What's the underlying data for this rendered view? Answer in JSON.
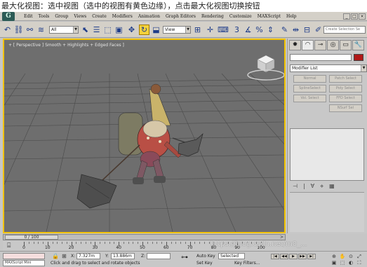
{
  "caption": "最大化视图：选中视图（选中的视图有黄色边缘），点击最大化视图切换按钮",
  "app": {
    "logo": "G",
    "menu": [
      "Edit",
      "Tools",
      "Group",
      "Views",
      "Create",
      "Modifiers",
      "Animation",
      "Graph Editors",
      "Rendering",
      "Customize",
      "MAXScript",
      "Help"
    ],
    "window_buttons": [
      "_",
      "□",
      "×"
    ]
  },
  "toolbar": {
    "selection_filter": "All",
    "reference_coord": "View",
    "search_placeholder": "Create Selection Se",
    "snap_label": "3",
    "angle_snap_label": "%"
  },
  "viewport": {
    "label": "+ [ Perspective ] Smooth + Highlights + Edged Faces ]",
    "active_border_color": "#f2c300"
  },
  "watermark": "https://blog.csdn.net/m0_...",
  "command_panel": {
    "tabs": [
      "✹",
      "◠",
      "⊸",
      "◎",
      "▭",
      "🔧"
    ],
    "modifier_list": "Modifier List",
    "buttons": [
      "Normal",
      "Patch Select",
      "SplineSelect",
      "Poly Select",
      "Vol. Select",
      "FFD Select",
      "",
      "NSurf Sel"
    ],
    "stack_tools": [
      "⊣",
      "|",
      "∀",
      "⋄",
      "▦"
    ]
  },
  "time": {
    "current": "0 / 100",
    "ticks": [
      "0",
      "10",
      "20",
      "30",
      "40",
      "50",
      "60",
      "70",
      "80",
      "90",
      "100"
    ]
  },
  "status": {
    "maxscript_label": "MAXScript Mini",
    "x_label": "X:",
    "x_value": "7.327m",
    "y_label": "Y:",
    "y_value": "13.886m",
    "z_label": "Z:",
    "z_value": "",
    "prompt": "Click and drag to select and rotate objects",
    "auto_key": "Auto Key",
    "set_key": "Set Key",
    "selected": "Selected",
    "key_filters": "Key Filters...",
    "playback": [
      "|◀",
      "◀◀",
      "▶",
      "▶▶",
      "▶|"
    ],
    "nav_icons": [
      "⊕",
      "✋",
      "⊙",
      "⤢",
      "▣",
      "⬚",
      "◐",
      "⛶"
    ]
  }
}
